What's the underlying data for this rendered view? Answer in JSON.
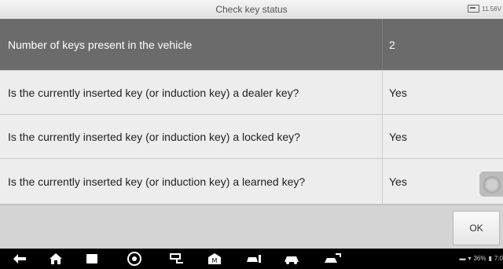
{
  "window": {
    "title": "Check key status",
    "battery_text": "11.56V"
  },
  "table": {
    "rows": [
      {
        "label": "Number of keys present in the vehicle",
        "value": "2"
      },
      {
        "label": "Is the currently inserted key (or induction key) a dealer key?",
        "value": "Yes"
      },
      {
        "label": "Is the currently inserted key (or induction key) a locked key?",
        "value": "Yes"
      },
      {
        "label": "Is the currently inserted key (or induction key) a learned key?",
        "value": "Yes"
      }
    ]
  },
  "footer": {
    "ok_label": "OK"
  },
  "navbar": {
    "icons": [
      "back-icon",
      "home-icon",
      "recent-apps-icon",
      "chrome-icon",
      "vci-connection-icon",
      "maxisys-icon",
      "car-service-icon",
      "car-icon",
      "car-diagnostics-icon"
    ],
    "battery_percent": "36%",
    "time": "7:0"
  }
}
